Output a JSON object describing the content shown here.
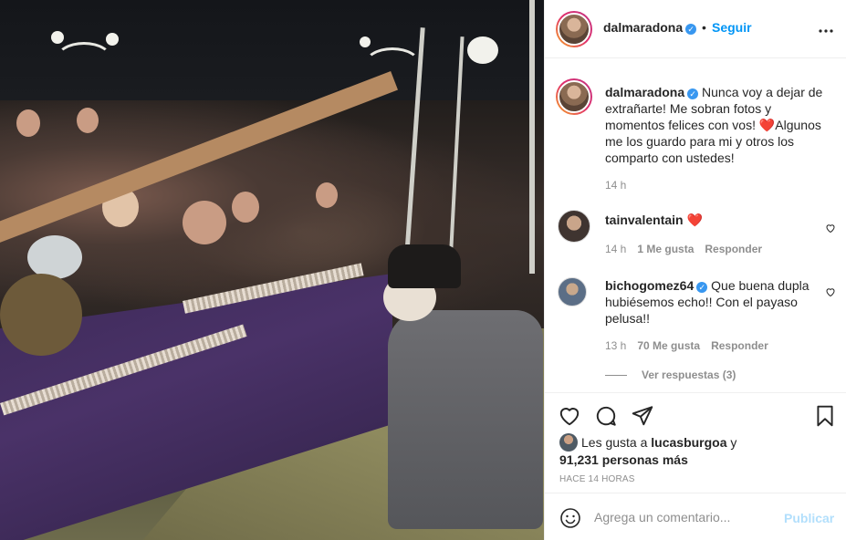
{
  "post": {
    "image_alt": "",
    "author": "dalmaradona",
    "follow_label": "Seguir",
    "separator": "•",
    "more_icon": "more-horizontal-icon",
    "verified_glyph": "✓"
  },
  "caption": {
    "username": "dalmaradona",
    "text": "Nunca voy a dejar de extrañarte! Me sobran fotos y momentos felices con vos! ❤️Algunos me los guardo para mi y otros los comparto con ustedes!",
    "time": "14 h"
  },
  "comments": [
    {
      "username": "tainvalentain",
      "text": "❤️",
      "time": "14 h",
      "likes": "1 Me gusta",
      "reply": "Responder",
      "verified": false
    },
    {
      "username": "bichogomez64",
      "text": "Que buena dupla hubiésemos echo!! Con el payaso pelusa!!",
      "time": "13 h",
      "likes": "70 Me gusta",
      "reply": "Responder",
      "verified": true
    }
  ],
  "view_replies": "Ver respuestas (3)",
  "actions": {
    "icons": [
      "heart-icon",
      "comment-icon",
      "share-icon",
      "bookmark-icon"
    ]
  },
  "likes": {
    "prefix": "Les gusta a",
    "user": "lucasburgoa",
    "connector": "y",
    "count": "91,231 personas más"
  },
  "time_ago": "HACE 14 HORAS",
  "add_comment": {
    "placeholder": "Agrega un comentario...",
    "publish_label": "Publicar"
  },
  "colors": {
    "link_blue": "#0095f6",
    "publish_disabled": "#b2dffc",
    "verified": "#3897f0",
    "like_red": "#ed4956"
  }
}
